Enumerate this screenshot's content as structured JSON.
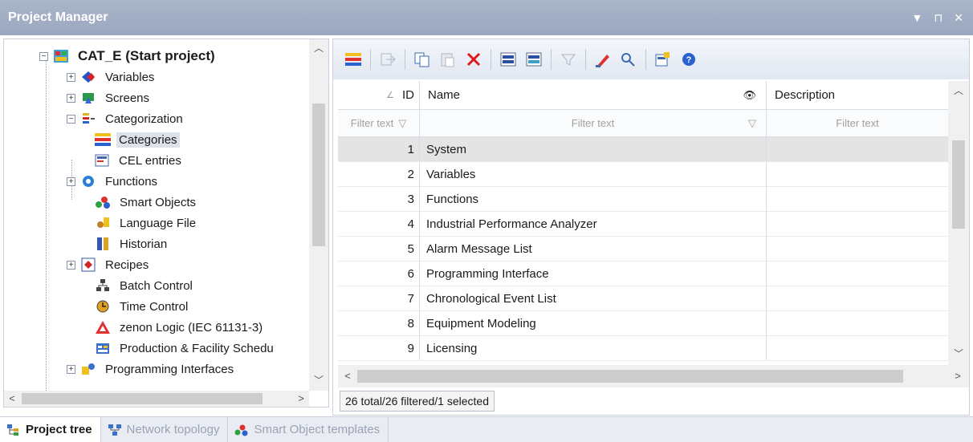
{
  "window": {
    "title": "Project Manager",
    "controls": [
      "▼",
      "⊓",
      "✕"
    ]
  },
  "tree": {
    "root": {
      "label": "CAT_E (Start project)",
      "icon": "project-icon"
    },
    "items": [
      {
        "label": "Variables",
        "icon": "variables-icon"
      },
      {
        "label": "Screens",
        "icon": "screens-icon"
      },
      {
        "label": "Categorization",
        "icon": "categorization-icon"
      },
      {
        "label": "Categories",
        "icon": "categories-icon"
      },
      {
        "label": "CEL entries",
        "icon": "cel-entries-icon"
      },
      {
        "label": "Functions",
        "icon": "functions-icon"
      },
      {
        "label": "Smart Objects",
        "icon": "smart-objects-icon"
      },
      {
        "label": "Language File",
        "icon": "language-file-icon"
      },
      {
        "label": "Historian",
        "icon": "historian-icon"
      },
      {
        "label": "Recipes",
        "icon": "recipes-icon"
      },
      {
        "label": "Batch Control",
        "icon": "batch-control-icon"
      },
      {
        "label": "Time Control",
        "icon": "time-control-icon"
      },
      {
        "label": "zenon Logic (IEC 61131-3)",
        "icon": "zenon-logic-icon"
      },
      {
        "label": "Production & Facility Schedu",
        "icon": "production-scheduler-icon"
      },
      {
        "label": "Programming Interfaces",
        "icon": "programming-interfaces-icon"
      }
    ],
    "selected": "Categories"
  },
  "grid": {
    "columns": {
      "id": "ID",
      "name": "Name",
      "description": "Description"
    },
    "filter": {
      "id": "Filter text",
      "name": "Filter text",
      "description": "Filter text"
    },
    "rows": [
      {
        "id": "1",
        "name": "System"
      },
      {
        "id": "2",
        "name": "Variables"
      },
      {
        "id": "3",
        "name": "Functions"
      },
      {
        "id": "4",
        "name": "Industrial Performance Analyzer"
      },
      {
        "id": "5",
        "name": "Alarm Message List"
      },
      {
        "id": "6",
        "name": "Programming Interface"
      },
      {
        "id": "7",
        "name": "Chronological Event List"
      },
      {
        "id": "8",
        "name": "Equipment Modeling"
      },
      {
        "id": "9",
        "name": "Licensing"
      }
    ],
    "selected_row": "1"
  },
  "status": "26 total/26 filtered/1 selected",
  "tabs": [
    {
      "label": "Project tree",
      "icon": "project-tree-icon",
      "active": true
    },
    {
      "label": "Network topology",
      "icon": "network-topology-icon",
      "active": false
    },
    {
      "label": "Smart Object templates",
      "icon": "smart-object-templates-icon",
      "active": false
    }
  ],
  "colors": {
    "titlebar": "#9aa7bf",
    "selected_row": "#e4e4e4",
    "toolbar": "#e1e7f1"
  }
}
